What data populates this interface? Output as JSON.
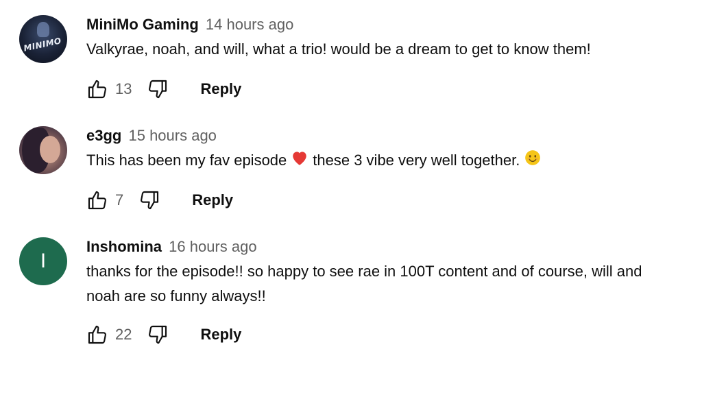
{
  "comments": [
    {
      "author": "MiniMo Gaming",
      "time": "14 hours ago",
      "text": "Valkyrae, noah, and will, what a trio! would be a dream to get to know them!",
      "likes": "13",
      "reply_label": "Reply",
      "avatar": {
        "type": "image",
        "logo_text": "MINIMO"
      }
    },
    {
      "author": "e3gg",
      "time": "15 hours ago",
      "text_before": "This has been my fav episode",
      "text_middle": "these 3 vibe very well together.",
      "likes": "7",
      "reply_label": "Reply",
      "avatar": {
        "type": "photo"
      },
      "emojis": [
        "red-heart-icon",
        "smiling-face-icon"
      ]
    },
    {
      "author": "Inshomina",
      "time": "16 hours ago",
      "text_line1": "thanks for the episode!! so happy to see rae in 100T content and of course, will and",
      "text_line2": "noah are so funny always!!",
      "likes": "22",
      "reply_label": "Reply",
      "avatar": {
        "type": "initial",
        "letter": "I",
        "color": "#1e6b4e"
      }
    }
  ],
  "colors": {
    "text_primary": "#0f0f0f",
    "text_secondary": "#606060",
    "heart": "#e53935",
    "smiley": "#f5c518"
  }
}
